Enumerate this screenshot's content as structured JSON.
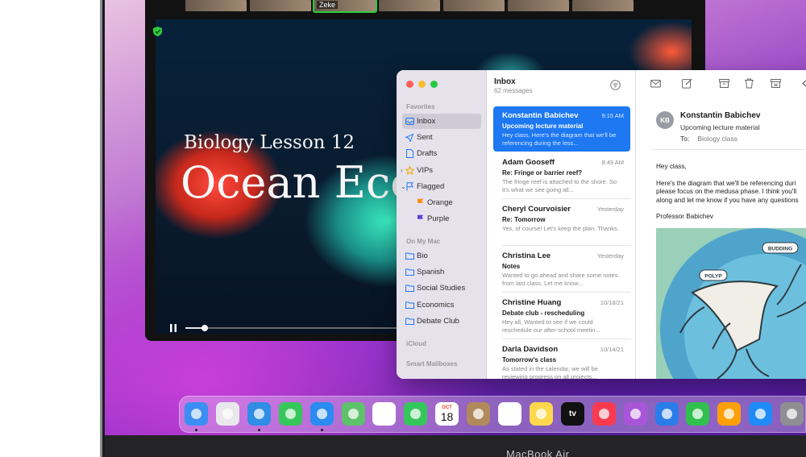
{
  "device": {
    "label": "MacBook Air"
  },
  "video_call": {
    "participant_name": "Zeke",
    "slide_subtitle": "Biology Lesson 12",
    "slide_title": "Ocean Eco",
    "playback_progress": 0.09
  },
  "mail": {
    "sidebar": {
      "favorites_label": "Favorites",
      "on_my_mac_label": "On My Mac",
      "icloud_label": "iCloud",
      "smart_mailboxes_label": "Smart Mailboxes",
      "favorites": [
        {
          "label": "Inbox",
          "icon": "inbox-icon"
        },
        {
          "label": "Sent",
          "icon": "paper-plane-icon"
        },
        {
          "label": "Drafts",
          "icon": "document-icon"
        },
        {
          "label": "VIPs",
          "icon": "star-icon"
        },
        {
          "label": "Flagged",
          "icon": "flag-icon"
        },
        {
          "label": "Orange",
          "icon": "flag-icon",
          "color": "#ff8a00"
        },
        {
          "label": "Purple",
          "icon": "flag-icon",
          "color": "#5b3fd6"
        }
      ],
      "folders": [
        {
          "label": "Bio"
        },
        {
          "label": "Spanish"
        },
        {
          "label": "Social Studies"
        },
        {
          "label": "Economics"
        },
        {
          "label": "Debate Club"
        }
      ]
    },
    "list": {
      "title": "Inbox",
      "count": "62 messages",
      "messages": [
        {
          "from": "Konstantin Babichev",
          "date": "9:15 AM",
          "subject": "Upcoming lecture material",
          "preview": "Hey class, Here's the diagram that we'll be referencing during the less..."
        },
        {
          "from": "Adam Gooseff",
          "date": "8:49 AM",
          "subject": "Re: Fringe or barrier reef?",
          "preview": "The fringe reef is attached to the shore. So it's what we see going all..."
        },
        {
          "from": "Cheryl Courvoisier",
          "date": "Yesterday",
          "subject": "Re: Tomorrow",
          "preview": "Yes, of course! Let's keep the plan. Thanks."
        },
        {
          "from": "Christina Lee",
          "date": "Yesterday",
          "subject": "Notes",
          "preview": "Wanted to go ahead and share some notes from last class. Let me know..."
        },
        {
          "from": "Christine Huang",
          "date": "10/18/21",
          "subject": "Debate club - rescheduling",
          "preview": "Hey all, Wanted to see if we could reschedule our after-school meetin..."
        },
        {
          "from": "Darla Davidson",
          "date": "10/14/21",
          "subject": "Tomorrow's class",
          "preview": "As stated in the calendar, we will be reviewing progress on all projects..."
        }
      ]
    },
    "reader": {
      "avatar_initials": "KB",
      "from": "Konstantin Babichev",
      "subject": "Upcoming lecture material",
      "to_label": "To:",
      "to": "Biology class",
      "body": [
        "Hey class,",
        "Here's the diagram that we'll be referencing duri",
        "please focus on the medusa phase. I think you'll",
        "along and let me know if you have any questions",
        "Professor Babichev"
      ],
      "diagram_labels": [
        "BUDDING",
        "POLYP"
      ]
    }
  },
  "dock": {
    "calendar": {
      "month": "OCT",
      "day": "18"
    },
    "apps": [
      {
        "name": "Finder",
        "icon": "finder-icon",
        "color": "#3b8ef2",
        "running": true
      },
      {
        "name": "Launchpad",
        "icon": "launchpad-icon",
        "color": "#e8e8ec",
        "running": false
      },
      {
        "name": "Safari",
        "icon": "safari-icon",
        "color": "#2f8de6",
        "running": true
      },
      {
        "name": "Messages",
        "icon": "messages-icon",
        "color": "#35c759",
        "running": false
      },
      {
        "name": "Mail",
        "icon": "mail-icon",
        "color": "#2a8cf0",
        "running": true
      },
      {
        "name": "Maps",
        "icon": "maps-icon",
        "color": "#5ec26a",
        "running": false
      },
      {
        "name": "Photos",
        "icon": "photos-icon",
        "color": "#ffffff",
        "running": false
      },
      {
        "name": "FaceTime",
        "icon": "facetime-icon",
        "color": "#34c759",
        "running": false
      },
      {
        "name": "Calendar",
        "icon": "calendar-icon",
        "color": "#ffffff",
        "running": false
      },
      {
        "name": "Contacts",
        "icon": "contacts-icon",
        "color": "#b08a5c",
        "running": false
      },
      {
        "name": "Reminders",
        "icon": "reminders-icon",
        "color": "#ffffff",
        "running": false
      },
      {
        "name": "Notes",
        "icon": "notes-icon",
        "color": "#ffd84d",
        "running": false
      },
      {
        "name": "TV",
        "icon": "tv-icon",
        "color": "#111111",
        "label": "tv",
        "running": false
      },
      {
        "name": "Music",
        "icon": "music-icon",
        "color": "#fa3b4f",
        "running": false
      },
      {
        "name": "Podcasts",
        "icon": "podcasts-icon",
        "color": "#a855d8",
        "running": false
      },
      {
        "name": "Keynote",
        "icon": "keynote-icon",
        "color": "#2b7de9",
        "running": false
      },
      {
        "name": "Numbers",
        "icon": "numbers-icon",
        "color": "#30c04f",
        "running": false
      },
      {
        "name": "Pages",
        "icon": "pages-icon",
        "color": "#ff9f0a",
        "running": false
      },
      {
        "name": "App Store",
        "icon": "app-store-icon",
        "color": "#1e8bf7",
        "running": false
      },
      {
        "name": "System Preferences",
        "icon": "system-preferences-icon",
        "color": "#8e8e93",
        "running": false
      }
    ]
  }
}
